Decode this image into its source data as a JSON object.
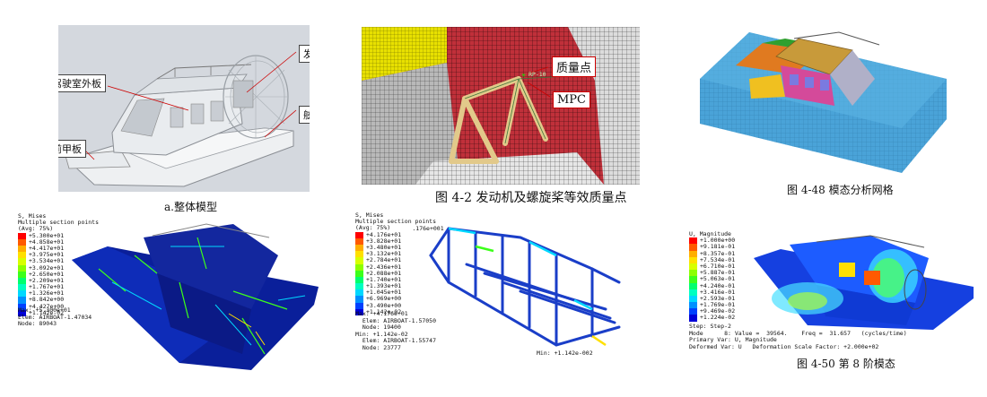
{
  "panel_a": {
    "label_dash": "驾驶室外板",
    "label_engine": "发动机",
    "label_side": "舷侧板",
    "label_front": "前甲板",
    "caption": "a.整体模型"
  },
  "panel_b": {
    "label_mass": "质量点",
    "label_mpc": "MPC",
    "label_rp": "RP-10",
    "caption": "图  4-2 发动机及螺旋桨等效质量点"
  },
  "panel_c": {
    "caption": "图 4-48 模态分析网格"
  },
  "stress1": {
    "title_lines": [
      "S, Mises",
      "Multiple section points",
      "(Avg: 75%)"
    ],
    "values": [
      "+5.300e+01",
      "+4.858e+01",
      "+4.417e+01",
      "+3.975e+01",
      "+3.534e+01",
      "+3.092e+01",
      "+2.650e+01",
      "+2.209e+01",
      "+1.767e+01",
      "+1.326e+01",
      "+8.842e+00",
      "+4.427e+00",
      "+1.142e-02"
    ],
    "info_lines": [
      "Max: +5.300e+01",
      "Elem: AIRBOAT-1.47034",
      "Node: 89043"
    ]
  },
  "stress2": {
    "title_lines": [
      "S, Mises",
      "Multiple section points",
      "(Avg: 75%)"
    ],
    "values": [
      "+4.176e+01",
      "+3.828e+01",
      "+3.480e+01",
      "+3.132e+01",
      "+2.784e+01",
      "+2.436e+01",
      "+2.088e+01",
      "+1.740e+01",
      "+1.393e+01",
      "+1.045e+01",
      "+6.969e+00",
      "+3.490e+00",
      "+1.142e-02"
    ],
    "info_lines": [
      "Max: +4.176e+01",
      "  Elem: AIRBOAT-1.57050",
      "  Node: 19400",
      "Min: +1.142e-02",
      "  Elem: AIRBOAT-1.55747",
      "  Node: 23777"
    ],
    "max_marker": "Max: +4.176e+001",
    "min_marker": "Min: +1.142e-002"
  },
  "mode": {
    "title_lines": [
      "U, Magnitude"
    ],
    "values": [
      "+1.000e+00",
      "+9.181e-01",
      "+8.357e-01",
      "+7.534e-01",
      "+6.710e-01",
      "+5.887e-01",
      "+5.063e-01",
      "+4.240e-01",
      "+3.416e-01",
      "+2.593e-01",
      "+1.769e-01",
      "+9.469e-02",
      "+1.224e-02"
    ],
    "info_lines": [
      "Step: Step-2",
      "Mode      8: Value =  39564.    Freq =  31.657   (cycles/time)",
      "Primary Var: U, Magnitude",
      "Deformed Var: U   Deformation Scale Factor: +2.000e+02"
    ],
    "caption": "图 4-50 第 8 阶模态"
  },
  "colors": {
    "contour": [
      "#ff0000",
      "#ff5a00",
      "#ffae00",
      "#ffe000",
      "#d8ff00",
      "#8cff00",
      "#3cff1a",
      "#00ff6e",
      "#00ffc0",
      "#00d8ff",
      "#0090ff",
      "#0040ff",
      "#0000d8"
    ]
  }
}
